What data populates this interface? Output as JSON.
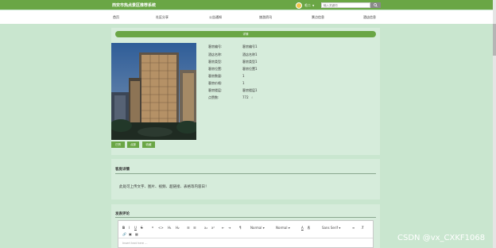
{
  "header": {
    "site_title": "西安市热点景区推荐系统",
    "username": "毛二",
    "search_placeholder": "输入关键词"
  },
  "nav": {
    "items": [
      "首页",
      "社区分享",
      "公告通知",
      "旅游资讯",
      "景点信息",
      "酒店信息"
    ]
  },
  "detail": {
    "header_label": "详情",
    "buttons": [
      "已赞",
      "点踩",
      "收藏"
    ],
    "fields": [
      {
        "label": "客房编号:",
        "value": "客房编号1"
      },
      {
        "label": "酒店名称:",
        "value": "酒店名称1"
      },
      {
        "label": "客房类型:",
        "value": "客房类型1"
      },
      {
        "label": "客房位置:",
        "value": "客房位置1"
      },
      {
        "label": "客房数量:",
        "value": "1"
      },
      {
        "label": "客房价格:",
        "value": "1"
      },
      {
        "label": "客房楼层:",
        "value": "客房楼层1"
      },
      {
        "label": "点赞数:",
        "value": "772"
      }
    ]
  },
  "room_detail": {
    "title": "客房详情",
    "content": "此处可上传文字、图片、视频、超链接、表格等内容日！"
  },
  "comment": {
    "title": "发表评论",
    "toolbar": {
      "bold": "B",
      "italic": "I",
      "underline": "U",
      "strike": "S",
      "quote": "❝",
      "code": "<>",
      "h1": "H₁",
      "h2": "H₂",
      "ol": "☰",
      "ul": "☰",
      "sub": "x₂",
      "sup": "x²",
      "indent_left": "⇤",
      "indent_right": "⇥",
      "rtl": "¶",
      "size_select": "Normal",
      "header_select": "Normal",
      "color": "A",
      "bg_color": "A",
      "font_select": "Sans Serif",
      "align": "≡",
      "clean": "T̸",
      "link": "🔗",
      "image": "▣",
      "video": "▦"
    },
    "placeholder": "Insert text here ..."
  },
  "watermark": "CSDN @vx_CXKF1068"
}
